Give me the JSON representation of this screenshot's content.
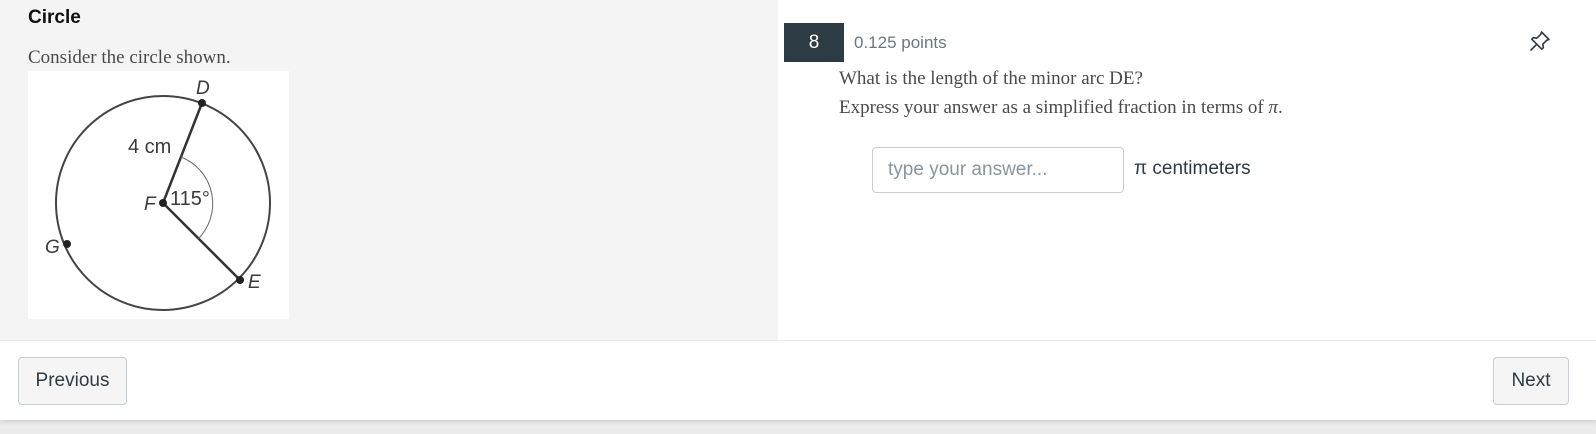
{
  "stimulus": {
    "title": "Circle",
    "prompt": "Consider the circle shown.",
    "figure": {
      "labels": {
        "d": "D",
        "e": "E",
        "f": "F",
        "g": "G",
        "radius": "4 cm",
        "angle": "115°"
      }
    }
  },
  "question": {
    "number": "8",
    "points": "0.125 points",
    "line1": "What is the length of the minor arc DE?",
    "line2_prefix": "Express your answer as a simplified fraction in terms of ",
    "line2_symbol": "π",
    "line2_suffix": ".",
    "answer": {
      "value": "",
      "placeholder": "type your answer..."
    },
    "units": "π centimeters"
  },
  "nav": {
    "previous": "Previous",
    "next": "Next"
  },
  "icons": {
    "pin": "pin-icon"
  },
  "colors": {
    "number_badge": "#2d3b45",
    "stimulus_bg": "#f4f4f4"
  }
}
